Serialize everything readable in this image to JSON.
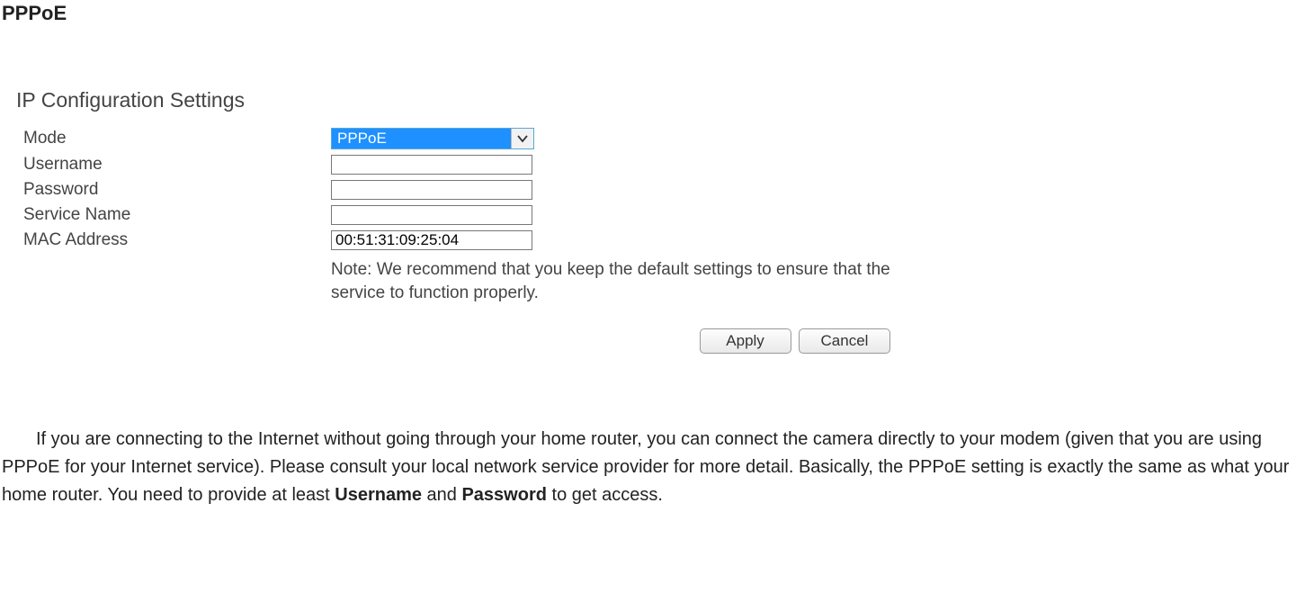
{
  "heading": "PPPoE",
  "panel": {
    "title": "IP Configuration Settings",
    "fields": {
      "mode": {
        "label": "Mode",
        "value": "PPPoE"
      },
      "username": {
        "label": "Username",
        "value": ""
      },
      "password": {
        "label": "Password",
        "value": ""
      },
      "service": {
        "label": "Service Name",
        "value": ""
      },
      "mac": {
        "label": "MAC Address",
        "value": "00:51:31:09:25:04"
      }
    },
    "note": "Note: We recommend that you keep the default settings to ensure that the service to function properly.",
    "buttons": {
      "apply": "Apply",
      "cancel": "Cancel"
    }
  },
  "description": {
    "t1": "If you are connecting to the Internet without going through your home router, you can connect the camera directly to your modem (given that you are using PPPoE for your Internet service). Please consult your local network service provider for more detail. Basically, the PPPoE setting is exactly the same as what your home router. You need to provide at least ",
    "b1": "Username",
    "t2": " and ",
    "b2": "Password",
    "t3": " to get access."
  }
}
